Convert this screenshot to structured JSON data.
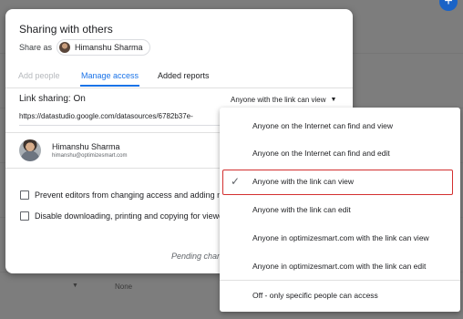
{
  "dialog": {
    "title": "Sharing with others",
    "share_as_label": "Share as",
    "share_as_user": "Himanshu Sharma",
    "tabs": [
      {
        "label": "Add people"
      },
      {
        "label": "Manage access"
      },
      {
        "label": "Added reports"
      }
    ],
    "active_tab": "Manage access",
    "link_sharing_label": "Link sharing: On",
    "link_sharing_value": "Anyone with the link can view",
    "url": "https://datastudio.google.com/datasources/6782b37e-",
    "user": {
      "name": "Himanshu Sharma",
      "email": "himanshu@optimizesmart.com"
    },
    "checkboxes": [
      {
        "label": "Prevent editors from changing access and adding n",
        "checked": false
      },
      {
        "label": "Disable downloading, printing and copying for viewe",
        "checked": false
      }
    ],
    "pending_text": "Pending chang"
  },
  "menu": {
    "items": [
      {
        "label": "Anyone on the Internet can find and view",
        "selected": false
      },
      {
        "label": "Anyone on the Internet can find and edit",
        "selected": false
      },
      {
        "label": "Anyone with the link can view",
        "selected": true
      },
      {
        "label": "Anyone with the link can edit",
        "selected": false
      },
      {
        "label": "Anyone in optimizesmart.com with the link can view",
        "selected": false
      },
      {
        "label": "Anyone in optimizesmart.com with the link can edit",
        "selected": false
      },
      {
        "label": "Off - only specific people can access",
        "selected": false
      }
    ],
    "check_glyph": "✓",
    "highlight_color": "#d32f2f"
  },
  "background": {
    "none_label": "None",
    "fab_glyph": "+"
  },
  "colors": {
    "accent": "#1a73e8",
    "highlight": "#d32f2f"
  }
}
